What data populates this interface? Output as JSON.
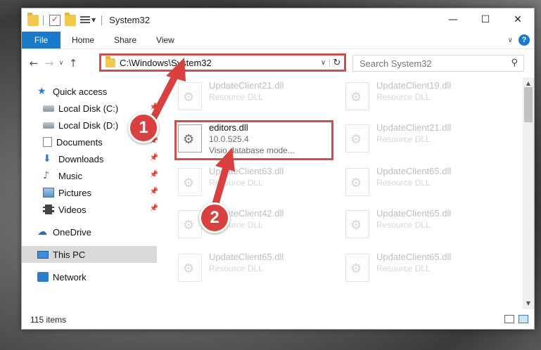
{
  "window": {
    "title": "System32"
  },
  "ribbon": {
    "file": "File",
    "tabs": [
      "Home",
      "Share",
      "View"
    ]
  },
  "address": {
    "path": "C:\\Windows\\System32",
    "search_placeholder": "Search System32"
  },
  "sidebar": {
    "quick_access": "Quick access",
    "items": [
      {
        "label": "Local Disk (C:)",
        "pinned": true
      },
      {
        "label": "Local Disk (D:)",
        "pinned": false
      },
      {
        "label": "Documents",
        "pinned": true
      },
      {
        "label": "Downloads",
        "pinned": true
      },
      {
        "label": "Music",
        "pinned": true
      },
      {
        "label": "Pictures",
        "pinned": true
      },
      {
        "label": "Videos",
        "pinned": true
      }
    ],
    "onedrive": "OneDrive",
    "this_pc": "This PC",
    "network": "Network"
  },
  "files": [
    {
      "name": "UpdateClient21.dll",
      "type": "Resource DLL"
    },
    {
      "name": "UpdateClient19.dll",
      "type": "Resource DLL"
    },
    {
      "name": "editors.dll",
      "version": "10.0.525.4",
      "description": "Visio database mode..."
    },
    {
      "name": "UpdateClient21.dll",
      "type": "Resource DLL"
    },
    {
      "name": "UpdateClient63.dll",
      "type": "Resource DLL"
    },
    {
      "name": "UpdateClient65.dll",
      "type": "Resource DLL"
    },
    {
      "name": "UpdateClient42.dll",
      "type": "Resource DLL"
    },
    {
      "name": "UpdateClient65.dll",
      "type": "Resource DLL"
    },
    {
      "name": "UpdateClient65.dll",
      "type": "Resource DLL"
    },
    {
      "name": "UpdateClient65.dll",
      "type": "Resource DLL"
    }
  ],
  "status": {
    "count": "115 items"
  },
  "callouts": {
    "one": "1",
    "two": "2"
  },
  "colors": {
    "accent": "#1979ca",
    "highlight": "#d94a4a"
  }
}
